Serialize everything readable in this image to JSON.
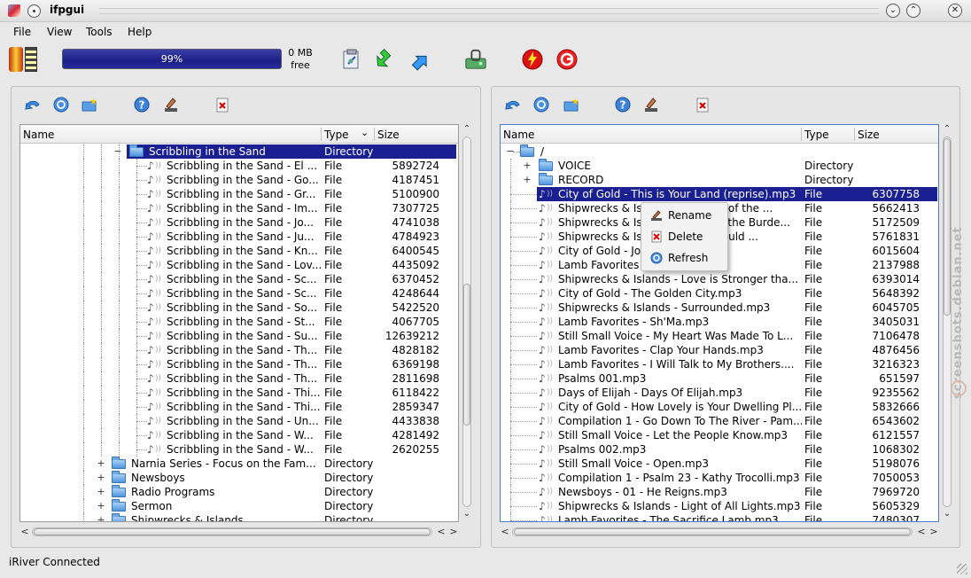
{
  "window": {
    "title": "ifpgui"
  },
  "menu": [
    "File",
    "View",
    "Tools",
    "Help"
  ],
  "storage": {
    "percent": "99%",
    "free_line1": "0 MB",
    "free_line2": "free",
    "fill": 0.99
  },
  "toolbar_icons": [
    "clipboard-icon",
    "download-arrow-icon",
    "upload-arrow-icon",
    "device-icon",
    "flash-icon",
    "refresh-circle-icon"
  ],
  "pane_toolbar_icons": [
    "back-arrow-icon",
    "refresh-icon",
    "new-folder-icon",
    "help-icon",
    "rename-icon",
    "delete-icon"
  ],
  "left": {
    "headers": {
      "name": "Name",
      "type": "Type",
      "size": "Size"
    },
    "selected_folder": {
      "name": "Scribbling in the Sand",
      "type": "Directory"
    },
    "files": [
      {
        "name": "Scribbling in the Sand - El ...",
        "type": "File",
        "size": "5892724"
      },
      {
        "name": "Scribbling in the Sand - Go...",
        "type": "File",
        "size": "4187451"
      },
      {
        "name": "Scribbling in the Sand - Gr...",
        "type": "File",
        "size": "5100900"
      },
      {
        "name": "Scribbling in the Sand - Im...",
        "type": "File",
        "size": "7307725"
      },
      {
        "name": "Scribbling in the Sand - Jo...",
        "type": "File",
        "size": "4741038"
      },
      {
        "name": "Scribbling in the Sand - Ju...",
        "type": "File",
        "size": "4784923"
      },
      {
        "name": "Scribbling in the Sand - Kn...",
        "type": "File",
        "size": "6400545"
      },
      {
        "name": "Scribbling in the Sand - Lov...",
        "type": "File",
        "size": "4435092"
      },
      {
        "name": "Scribbling in the Sand - Sc...",
        "type": "File",
        "size": "6370452"
      },
      {
        "name": "Scribbling in the Sand - Sc...",
        "type": "File",
        "size": "4248644"
      },
      {
        "name": "Scribbling in the Sand - So...",
        "type": "File",
        "size": "5422520"
      },
      {
        "name": "Scribbling in the Sand - St...",
        "type": "File",
        "size": "4067705"
      },
      {
        "name": "Scribbling in the Sand - Su...",
        "type": "File",
        "size": "12639212"
      },
      {
        "name": "Scribbling in the Sand - Th...",
        "type": "File",
        "size": "4828182"
      },
      {
        "name": "Scribbling in the Sand - Th...",
        "type": "File",
        "size": "6369198"
      },
      {
        "name": "Scribbling in the Sand - Th...",
        "type": "File",
        "size": "2811698"
      },
      {
        "name": "Scribbling in the Sand - Thi...",
        "type": "File",
        "size": "6118422"
      },
      {
        "name": "Scribbling in the Sand - Thi...",
        "type": "File",
        "size": "2859347"
      },
      {
        "name": "Scribbling in the Sand - Un...",
        "type": "File",
        "size": "4433838"
      },
      {
        "name": "Scribbling in the Sand - W...",
        "type": "File",
        "size": "4281492"
      },
      {
        "name": "Scribbling in the Sand - W...",
        "type": "File",
        "size": "2620255"
      }
    ],
    "folders": [
      {
        "name": "Narnia Series - Focus on the Fam...",
        "type": "Directory"
      },
      {
        "name": "Newsboys",
        "type": "Directory"
      },
      {
        "name": "Radio Programs",
        "type": "Directory"
      },
      {
        "name": "Sermon",
        "type": "Directory"
      },
      {
        "name": "Shipwrecks & Islands",
        "type": "Directory"
      }
    ]
  },
  "right": {
    "headers": {
      "name": "Name",
      "type": "Type",
      "size": "Size"
    },
    "root": "/",
    "folders": [
      {
        "name": "VOICE",
        "type": "Directory"
      },
      {
        "name": "RECORD",
        "type": "Directory"
      }
    ],
    "files": [
      {
        "name": "City of Gold - This is Your Land (reprise).mp3",
        "type": "File",
        "size": "6307758",
        "selected": true
      },
      {
        "name": "Shipwrecks & Islands - Member of the ...",
        "type": "File",
        "size": "5662413"
      },
      {
        "name": "Shipwrecks & Islands - Lay it at the Burde...",
        "type": "File",
        "size": "5172509"
      },
      {
        "name": "Shipwrecks & Islands - Jesus Would ...",
        "type": "File",
        "size": "5761831"
      },
      {
        "name": "City of Gold - Jordan.mp3",
        "type": "File",
        "size": "6015604"
      },
      {
        "name": "Lamb Favorites - Ha Shem.mp3",
        "type": "File",
        "size": "2137988"
      },
      {
        "name": "Shipwrecks & Islands - Love is Stronger tha...",
        "type": "File",
        "size": "6393014"
      },
      {
        "name": "City of Gold - The Golden City.mp3",
        "type": "File",
        "size": "5648392"
      },
      {
        "name": "Shipwrecks & Islands - Surrounded.mp3",
        "type": "File",
        "size": "6045705"
      },
      {
        "name": "Lamb Favorites - Sh'Ma.mp3",
        "type": "File",
        "size": "3405031"
      },
      {
        "name": "Still Small Voice - My Heart Was Made To L...",
        "type": "File",
        "size": "7106478"
      },
      {
        "name": "Lamb Favorites - Clap Your Hands.mp3",
        "type": "File",
        "size": "4876456"
      },
      {
        "name": "Lamb Favorites - I Will Talk to My Brothers....",
        "type": "File",
        "size": "3216323"
      },
      {
        "name": "Psalms 001.mp3",
        "type": "File",
        "size": "651597"
      },
      {
        "name": "Days of Elijah - Days Of Elijah.mp3",
        "type": "File",
        "size": "9235562"
      },
      {
        "name": "City of Gold - How Lovely is Your Dwelling Pl...",
        "type": "File",
        "size": "5832666"
      },
      {
        "name": "Compilation 1 - Go Down To The River - Pam...",
        "type": "File",
        "size": "6543602"
      },
      {
        "name": "Still Small Voice - Let the People Know.mp3",
        "type": "File",
        "size": "6121557"
      },
      {
        "name": "Psalms 002.mp3",
        "type": "File",
        "size": "1068302"
      },
      {
        "name": "Still Small Voice - Open.mp3",
        "type": "File",
        "size": "5198076"
      },
      {
        "name": "Compilation 1 - Psalm 23 - Kathy Trocolli.mp3",
        "type": "File",
        "size": "7050053"
      },
      {
        "name": "Newsboys - 01 - He Reigns.mp3",
        "type": "File",
        "size": "7969720"
      },
      {
        "name": "Shipwrecks & Islands - Light of All Lights.mp3",
        "type": "File",
        "size": "5605329"
      },
      {
        "name": "Lamb Favorites - The Sacrifice Lamb.mp3",
        "type": "File",
        "size": "7480307"
      }
    ]
  },
  "context_menu": [
    "Rename",
    "Delete",
    "Refresh"
  ],
  "status": "iRiver Connected",
  "watermark": "screenshots.debian.net"
}
